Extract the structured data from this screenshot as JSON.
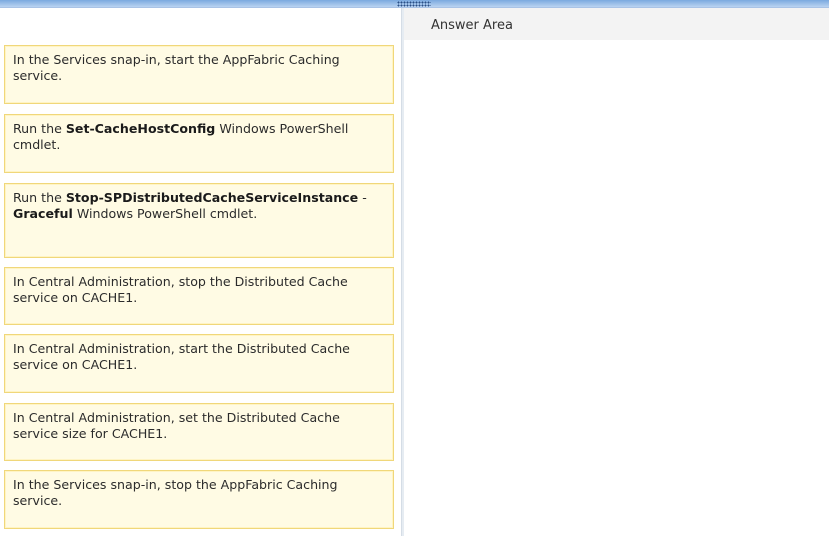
{
  "answer_area": {
    "title": "Answer Area"
  },
  "cards": [
    {
      "segments": [
        {
          "text": "In the Services snap-in, start the AppFabric Caching service.",
          "bold": false
        }
      ]
    },
    {
      "segments": [
        {
          "text": "Run the ",
          "bold": false
        },
        {
          "text": "Set-CacheHostConfig",
          "bold": true
        },
        {
          "text": " Windows PowerShell cmdlet.",
          "bold": false
        }
      ]
    },
    {
      "segments": [
        {
          "text": "Run the ",
          "bold": false
        },
        {
          "text": "Stop-SPDistributedCacheServiceInstance",
          "bold": true
        },
        {
          "text": " -",
          "bold": false
        },
        {
          "text": "Graceful",
          "bold": true
        },
        {
          "text": " Windows PowerShell cmdlet.",
          "bold": false
        }
      ]
    },
    {
      "segments": [
        {
          "text": "In Central Administration, stop the Distributed Cache service on CACHE1.",
          "bold": false
        }
      ]
    },
    {
      "segments": [
        {
          "text": "In Central Administration, start the Distributed Cache service on CACHE1.",
          "bold": false
        }
      ]
    },
    {
      "segments": [
        {
          "text": "In Central Administration, set the Distributed Cache service size for CACHE1.",
          "bold": false
        }
      ]
    },
    {
      "segments": [
        {
          "text": "In the Services snap-in, stop the AppFabric Caching service.",
          "bold": false
        }
      ]
    }
  ]
}
